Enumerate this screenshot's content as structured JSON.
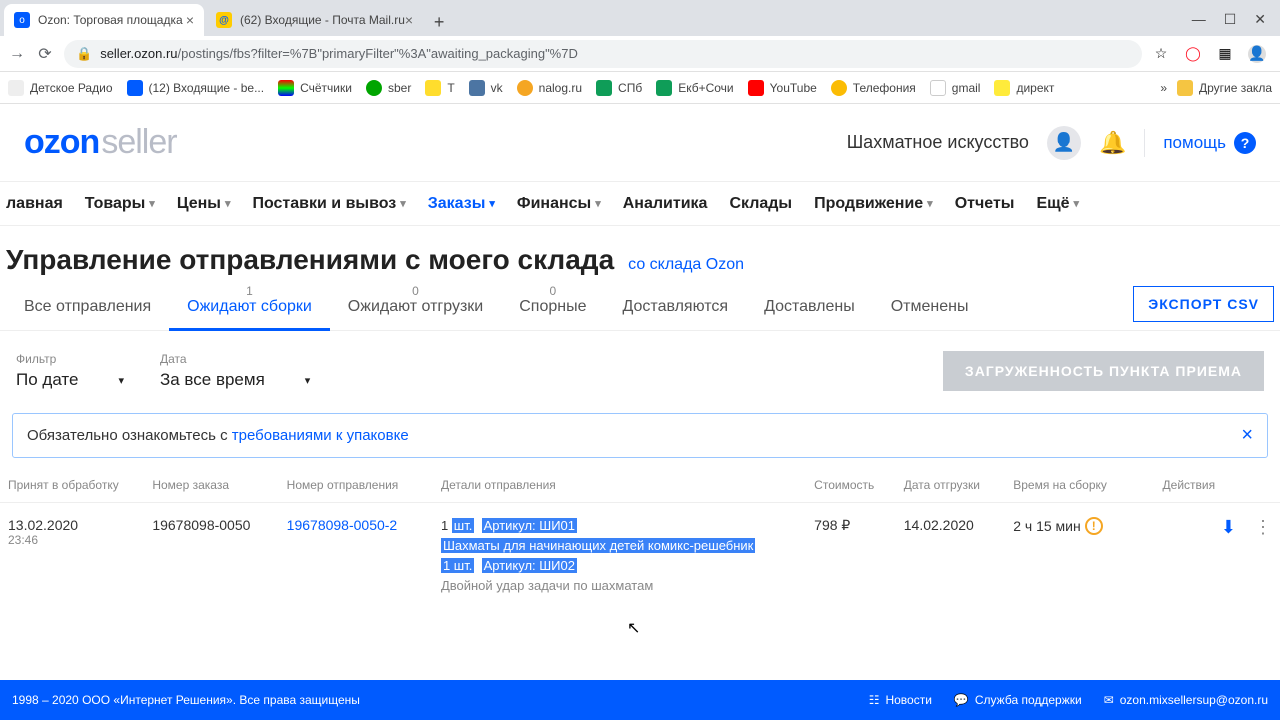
{
  "browser": {
    "tabs": [
      {
        "title": "Ozon: Торговая площадка"
      },
      {
        "title": "(62) Входящие - Почта Mail.ru"
      }
    ],
    "url_prefix": "seller.ozon.ru",
    "url_path": "/postings/fbs?filter=%7B\"primaryFilter\"%3A\"awaiting_packaging\"%7D",
    "bookmarks": [
      "Детское Радио",
      "(12) Входящие - be...",
      "Счётчики",
      "sber",
      "Т",
      "vk",
      "nalog.ru",
      "СПб",
      "Екб+Сочи",
      "YouTube",
      "Телефония",
      "gmail",
      "директ"
    ],
    "bm_more": "»",
    "bm_folder": "Другие закла"
  },
  "header": {
    "logo_a": "ozon",
    "logo_b": "seller",
    "shop": "Шахматное искусство",
    "help": "помощь"
  },
  "nav": {
    "items": [
      "лавная",
      "Товары",
      "Цены",
      "Поставки и вывоз",
      "Заказы",
      "Финансы",
      "Аналитика",
      "Склады",
      "Продвижение",
      "Отчеты",
      "Ещё"
    ],
    "has_chev": [
      false,
      true,
      true,
      true,
      true,
      true,
      false,
      false,
      true,
      false,
      true
    ],
    "blue_idx": 4
  },
  "title": {
    "main": "Управление отправлениями с моего склада",
    "link": "со склада Ozon"
  },
  "status_tabs": {
    "items": [
      {
        "label": "Все отправления",
        "count": ""
      },
      {
        "label": "Ожидают сборки",
        "count": "1"
      },
      {
        "label": "Ожидают отгрузки",
        "count": "0"
      },
      {
        "label": "Спорные",
        "count": "0"
      },
      {
        "label": "Доставляются",
        "count": ""
      },
      {
        "label": "Доставлены",
        "count": ""
      },
      {
        "label": "Отменены",
        "count": ""
      }
    ],
    "active_idx": 1,
    "export": "ЭКСПОРТ CSV"
  },
  "filters": {
    "f1_label": "Фильтр",
    "f1_val": "По дате",
    "f2_label": "Дата",
    "f2_val": "За все время",
    "btn": "ЗАГРУЖЕННОСТЬ ПУНКТА ПРИЕМА"
  },
  "notice": {
    "text": "Обязательно ознакомьтесь с ",
    "link": "требованиями к упаковке"
  },
  "table": {
    "headers": [
      "Принят в обработку",
      "Номер заказа",
      "Номер отправления",
      "Детали отправления",
      "Стоимость",
      "Дата отгрузки",
      "Время на сборку",
      "Действия"
    ],
    "row": {
      "date": "13.02.2020",
      "time": "23:46",
      "order": "19678098-0050",
      "shipment": "19678098-0050-2",
      "d1_qty": "1",
      "d1_unit": "шт.",
      "d1_art": "Артикул: ШИ01",
      "d1_name": "Шахматы для начинающих детей комикс-решебник",
      "d2_qty": "1 шт.",
      "d2_art": "Артикул: ШИ02",
      "d2_name": "Двойной удар задачи по шахматам",
      "cost": "798 ₽",
      "ship_date": "14.02.2020",
      "assembly": "2 ч 15 мин"
    }
  },
  "footer": {
    "copy": "1998 – 2020 ООО «Интернет Решения». Все права защищены",
    "news": "Новости",
    "support": "Служба поддержки",
    "email": "ozon.mixsellersup@ozon.ru"
  }
}
